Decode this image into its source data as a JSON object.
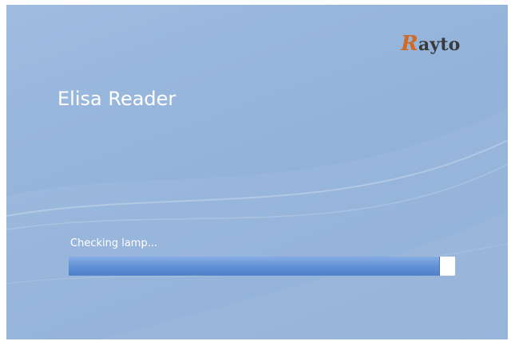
{
  "window": {
    "app_title": "Elisa Reader",
    "logo_text": "Rayto",
    "logo_mark": "R",
    "logo_rest": "ayto"
  },
  "loading": {
    "status_text": "Checking lamp...",
    "progress_fraction": 0.96
  },
  "colors": {
    "background": "#93b3da",
    "logo_accent": "#d06a25",
    "progress_fill": "#5f8fd3",
    "progress_track": "#ffffff"
  }
}
